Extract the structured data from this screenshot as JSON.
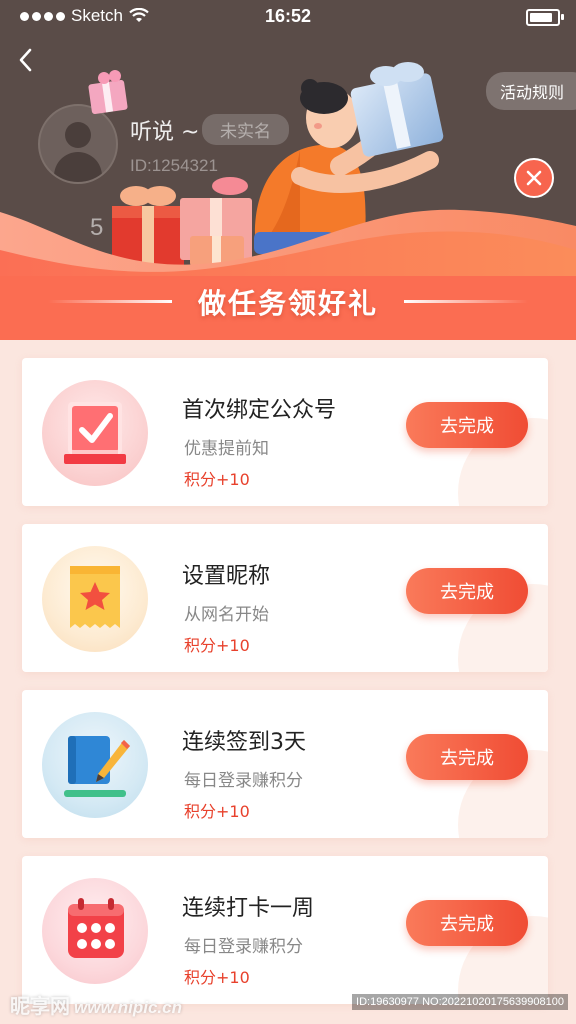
{
  "status_bar": {
    "carrier": "Sketch",
    "time": "16:52"
  },
  "profile": {
    "name": "听说 ~",
    "badge": "未实名",
    "id": "ID:1254321",
    "count": "5"
  },
  "header": {
    "rules_label": "活动规则",
    "title": "做任务领好礼"
  },
  "tasks": [
    {
      "title": "首次绑定公众号",
      "subtitle": "优惠提前知",
      "points": "积分+10",
      "button": "去完成",
      "icon": "checked-document-icon"
    },
    {
      "title": "设置昵称",
      "subtitle": "从网名开始",
      "points": "积分+10",
      "button": "去完成",
      "icon": "star-ticket-icon"
    },
    {
      "title": "连续签到3天",
      "subtitle": "每日登录赚积分",
      "points": "积分+10",
      "button": "去完成",
      "icon": "pencil-notebook-icon"
    },
    {
      "title": "连续打卡一周",
      "subtitle": "每日登录赚积分",
      "points": "积分+10",
      "button": "去完成",
      "icon": "calendar-dots-icon"
    }
  ],
  "watermark": {
    "site": "昵享网",
    "url": "www.nipic.cn",
    "code": "ID:19630977 NO:20221020175639908100"
  },
  "colors": {
    "accent": "#f04c34",
    "header_dark": "#5a4c48",
    "banner_orange": "#fa7a5a",
    "page_bg": "#fbe6df"
  }
}
